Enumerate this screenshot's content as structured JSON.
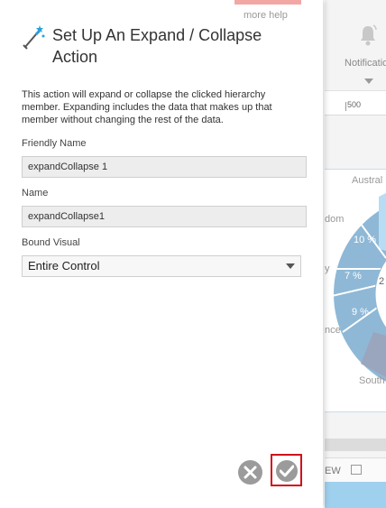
{
  "dialog": {
    "more_help": "more help",
    "title": "Set Up An Expand / Collapse Action",
    "description": "This action will expand or collapse the clicked hierarchy member. Expanding includes the data that makes up that member without changing the rest of the data.",
    "fields": {
      "friendly_name": {
        "label": "Friendly Name",
        "value": "expandCollapse 1"
      },
      "name": {
        "label": "Name",
        "value": "expandCollapse1"
      },
      "bound_visual": {
        "label": "Bound Visual",
        "value": "Entire Control"
      }
    },
    "buttons": {
      "cancel": "close-icon",
      "ok": "check-icon"
    }
  },
  "background": {
    "notifications_label": "Notificatio",
    "ruler_label": "500",
    "chart_labels": {
      "top": "Austral",
      "left1": "dom",
      "left2": "y",
      "left3": "nce",
      "bottom": "South"
    },
    "donut_percents": [
      "10 %",
      "7 %",
      "9 %",
      "2"
    ],
    "preview_label": "EW"
  },
  "colors": {
    "accent_red": "#d0111b",
    "help_strip": "#f2a7a4",
    "donut_blue": "#8eb8d6",
    "bottom_bar": "#9fd0ee"
  }
}
